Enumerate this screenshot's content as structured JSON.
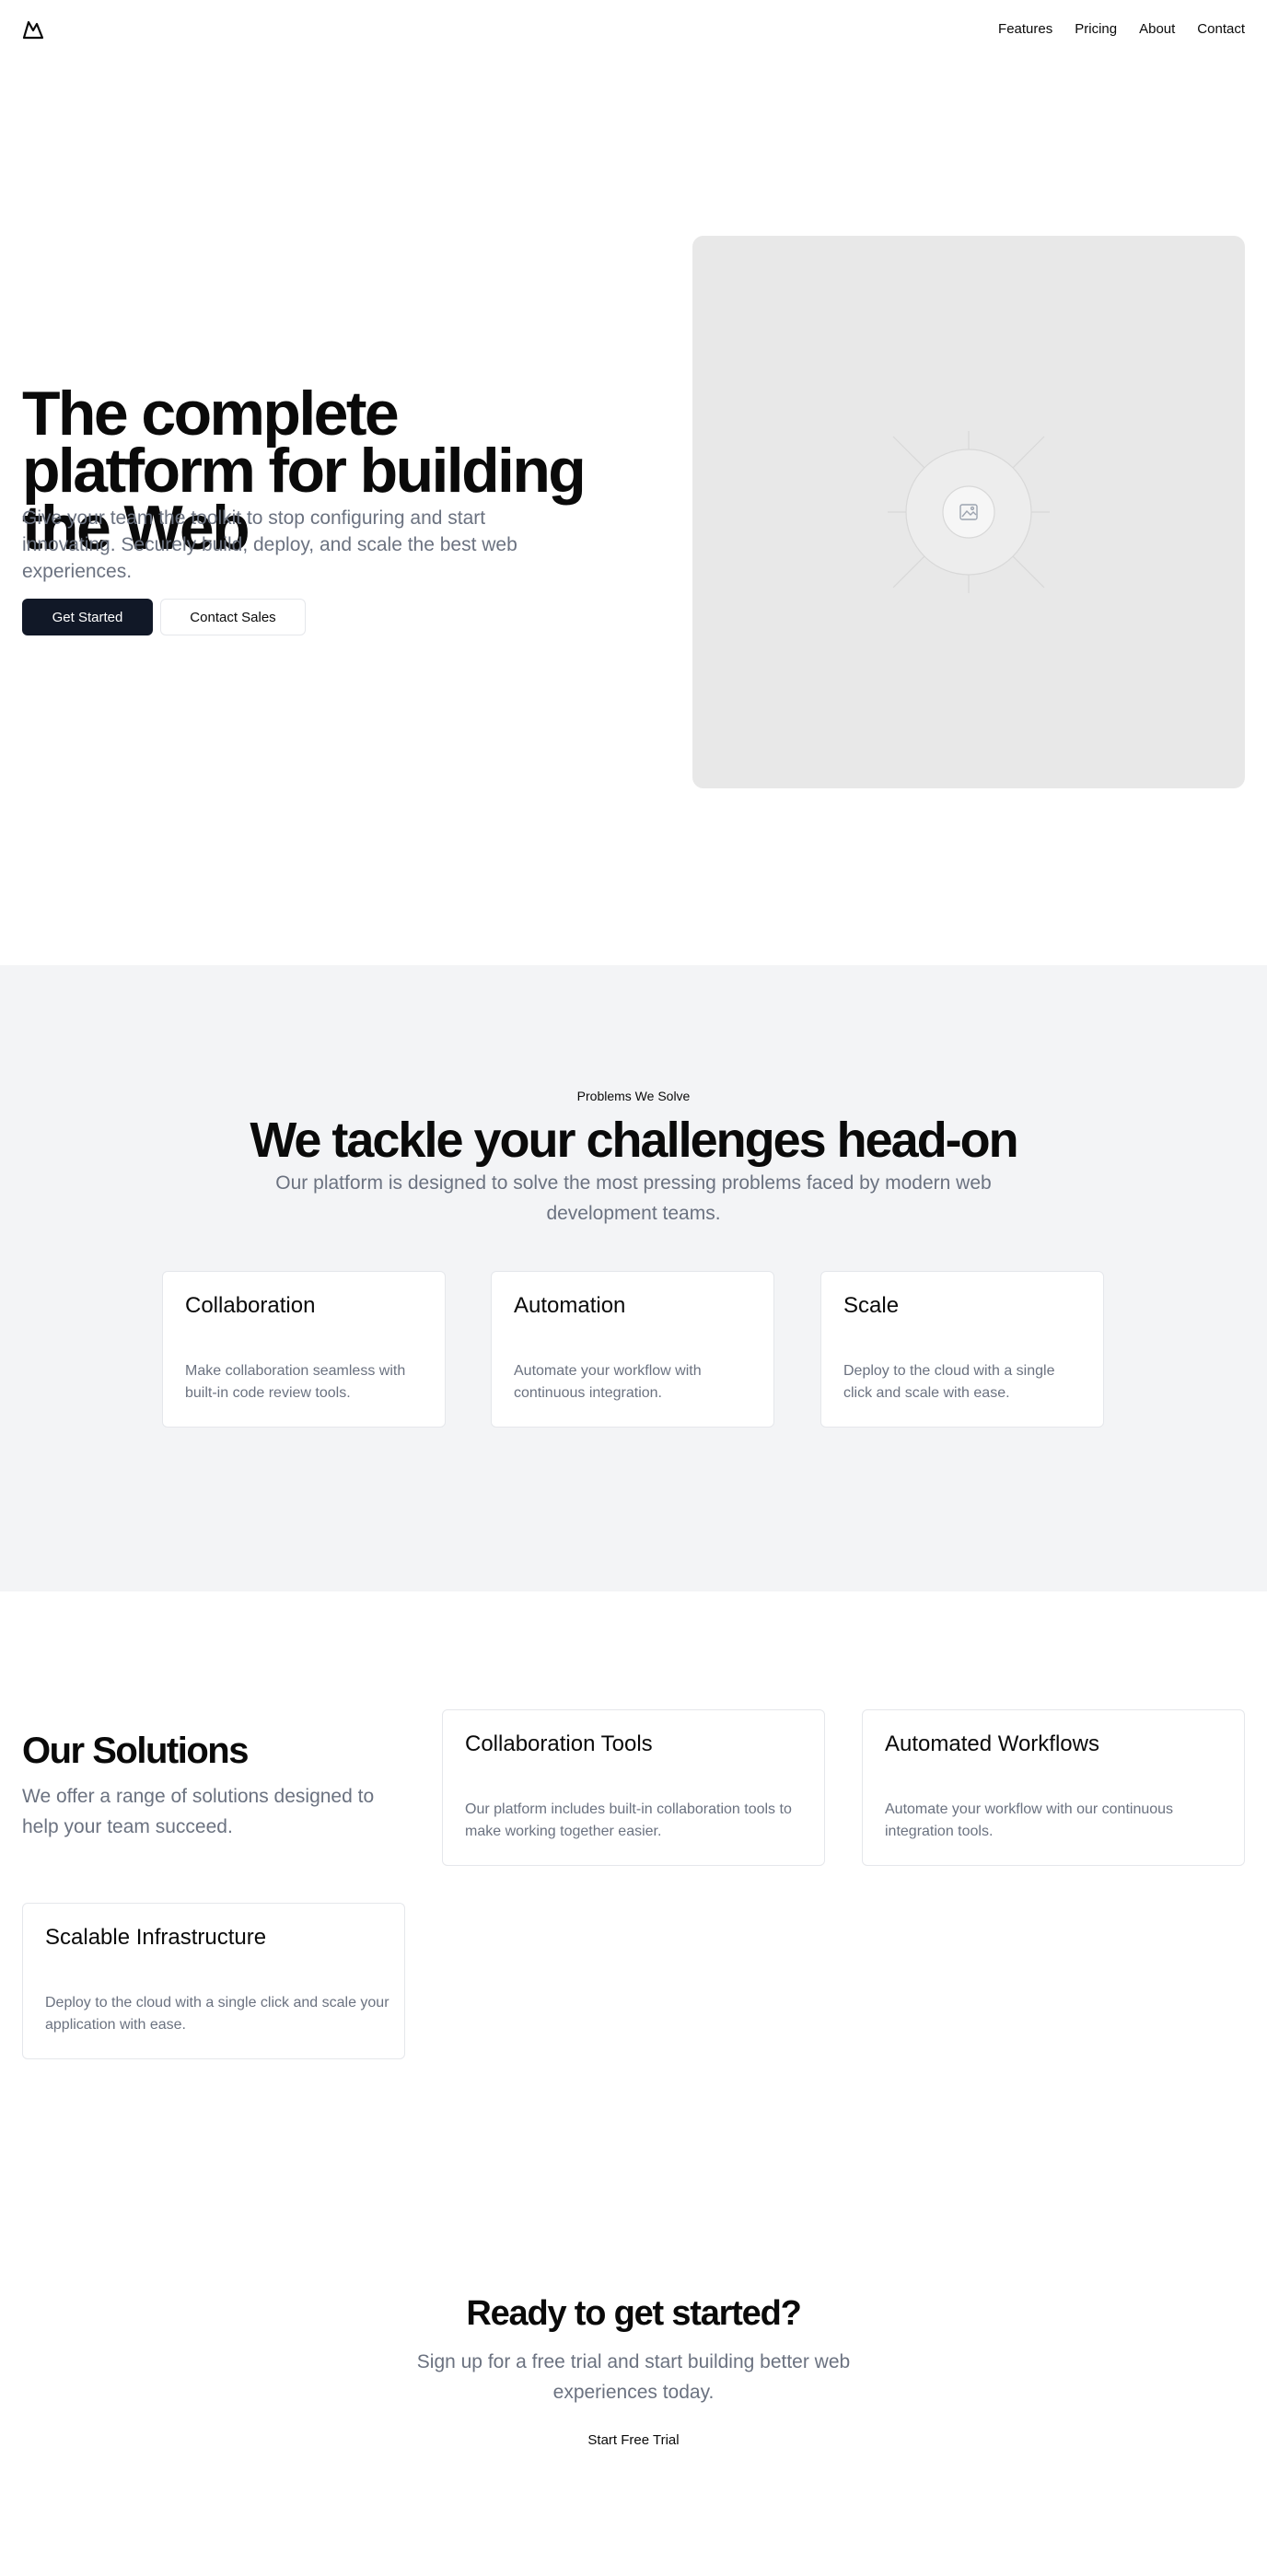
{
  "nav": {
    "logo_icon": "mountain-logo-icon",
    "links": [
      "Features",
      "Pricing",
      "About",
      "Contact"
    ]
  },
  "hero": {
    "title": "The complete platform for building the Web",
    "subtitle": "Give your team the toolkit to stop configuring and start innovating. Securely build, deploy, and scale the best web experiences.",
    "primary_cta": "Get Started",
    "secondary_cta": "Contact Sales",
    "image_icon": "image-placeholder-icon"
  },
  "problems": {
    "eyebrow": "Problems We Solve",
    "title": "We tackle your challenges head-on",
    "subtitle": "Our platform is designed to solve the most pressing problems faced by modern web development teams.",
    "cards": [
      {
        "title": "Collaboration",
        "text": "Make collaboration seamless with built-in code review tools."
      },
      {
        "title": "Automation",
        "text": "Automate your workflow with continuous integration."
      },
      {
        "title": "Scale",
        "text": "Deploy to the cloud with a single click and scale with ease."
      }
    ]
  },
  "solutions": {
    "title": "Our Solutions",
    "subtitle": "We offer a range of solutions designed to help your team succeed.",
    "cards": [
      {
        "title": "Collaboration Tools",
        "text": "Our platform includes built-in collaboration tools to make working together easier."
      },
      {
        "title": "Automated Workflows",
        "text": "Automate your workflow with our continuous integration tools."
      },
      {
        "title": "Scalable Infrastructure",
        "text": "Deploy to the cloud with a single click and scale your application with ease."
      }
    ]
  },
  "cta": {
    "title": "Ready to get started?",
    "subtitle": "Sign up for a free trial and start building better web experiences today.",
    "button": "Start Free Trial"
  },
  "colors": {
    "primary_button": "#111827",
    "muted_text": "#6b7280",
    "section_bg": "#f3f4f6",
    "placeholder_bg": "#e8e8e8"
  }
}
